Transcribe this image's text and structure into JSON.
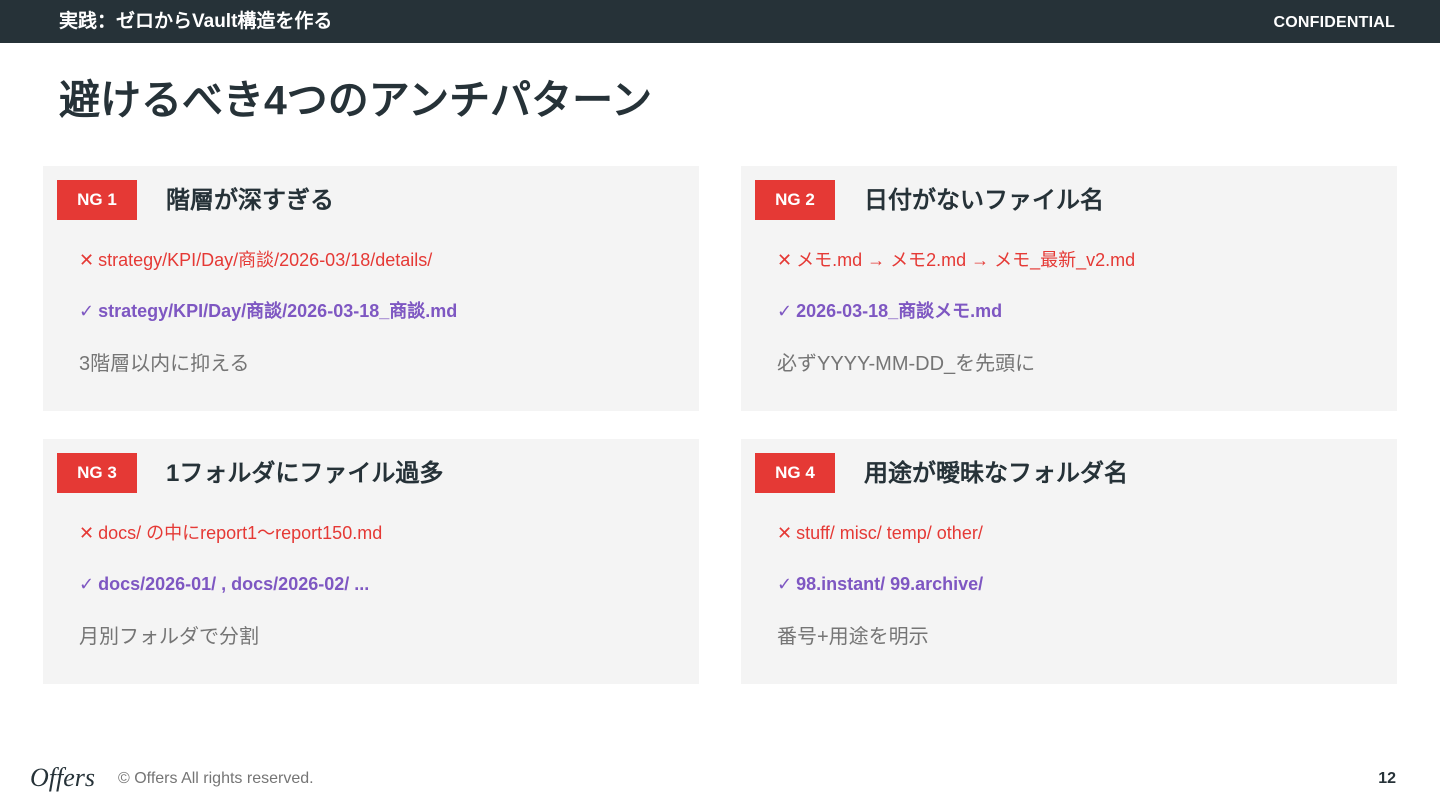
{
  "header": {
    "section_title": "実践：ゼロからVault構造を作る",
    "confidential": "CONFIDENTIAL"
  },
  "title": "避けるべき4つのアンチパターン",
  "cards": [
    {
      "badge": "NG 1",
      "title": "階層が深すぎる",
      "ng_mark": "✕",
      "ng": "strategy/KPI/Day/商談/2026-03/18/details/",
      "ok_mark": "✓",
      "ok": "strategy/KPI/Day/商談/2026-03-18_商談.md",
      "note": "3階層以内に抑える"
    },
    {
      "badge": "NG 2",
      "title": "日付がないファイル名",
      "ng_mark": "✕",
      "ng": "メモ.md → メモ2.md → メモ_最新_v2.md",
      "ok_mark": "✓",
      "ok": "2026-03-18_商談メモ.md",
      "note": "必ずYYYY-MM-DD_を先頭に"
    },
    {
      "badge": "NG 3",
      "title": "1フォルダにファイル過多",
      "ng_mark": "✕",
      "ng": "docs/ の中にreport1〜report150.md",
      "ok_mark": "✓",
      "ok": "docs/2026-01/ , docs/2026-02/ ...",
      "note": "月別フォルダで分割"
    },
    {
      "badge": "NG 4",
      "title": "用途が曖昧なフォルダ名",
      "ng_mark": "✕",
      "ng": "stuff/ misc/ temp/ other/",
      "ok_mark": "✓",
      "ok": "98.instant/ 99.archive/",
      "note": "番号+用途を明示"
    }
  ],
  "footer": {
    "logo": "Offers",
    "copyright": "© Offers All rights reserved.",
    "page_number": "12"
  },
  "colors": {
    "header_bg": "#263238",
    "ng_red": "#e53935",
    "ok_purple": "#7e57c2",
    "card_bg": "#f4f4f4"
  }
}
